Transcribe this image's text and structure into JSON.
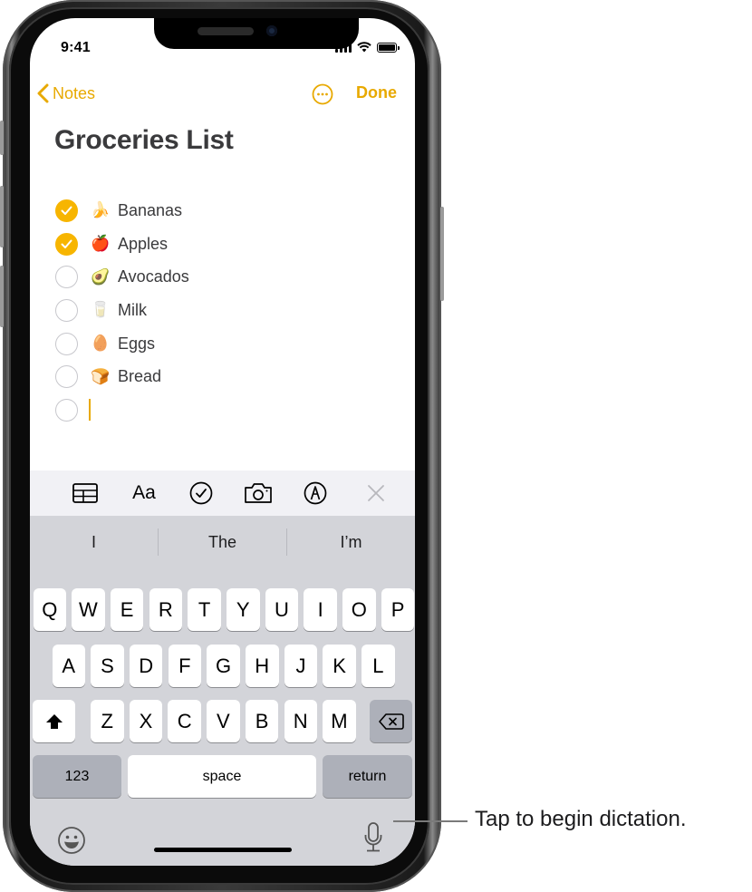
{
  "status_bar": {
    "time": "9:41",
    "signal_bars": 4,
    "battery_percent": 100
  },
  "nav": {
    "back_label": "Notes",
    "more_icon": "ellipsis-circle-icon",
    "done_label": "Done"
  },
  "note": {
    "title": "Groceries List",
    "items": [
      {
        "emoji": "🍌",
        "label": "Bananas",
        "checked": true
      },
      {
        "emoji": "🍎",
        "label": "Apples",
        "checked": true
      },
      {
        "emoji": "🥑",
        "label": "Avocados",
        "checked": false
      },
      {
        "emoji": "🥛",
        "label": "Milk",
        "checked": false
      },
      {
        "emoji": "🥚",
        "label": "Eggs",
        "checked": false
      },
      {
        "emoji": "🍞",
        "label": "Bread",
        "checked": false
      }
    ],
    "empty_item_checked": false
  },
  "toolbar": {
    "items": [
      "table-icon",
      "text-format-icon",
      "checklist-icon",
      "camera-icon",
      "markup-icon",
      "close-icon"
    ],
    "format_label": "Aa"
  },
  "keyboard": {
    "suggestions": [
      "I",
      "The",
      "I’m"
    ],
    "row1": [
      "Q",
      "W",
      "E",
      "R",
      "T",
      "Y",
      "U",
      "I",
      "O",
      "P"
    ],
    "row2": [
      "A",
      "S",
      "D",
      "F",
      "G",
      "H",
      "J",
      "K",
      "L"
    ],
    "row3": [
      "Z",
      "X",
      "C",
      "V",
      "B",
      "N",
      "M"
    ],
    "numbers_label": "123",
    "space_label": "space",
    "return_label": "return"
  },
  "callout": {
    "text": "Tap to begin dictation."
  },
  "colors": {
    "accent": "#e8a900",
    "checkbox_fill": "#f7b500",
    "keyboard_bg": "#d3d4d9",
    "toolbar_bg": "#f1f1f5"
  }
}
